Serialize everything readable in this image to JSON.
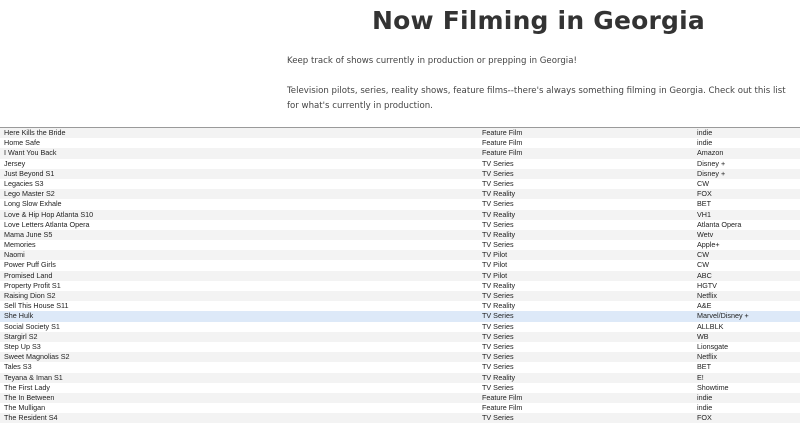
{
  "page": {
    "title": "Now Filming in Georgia",
    "intro_1": "Keep track of shows currently in production or prepping in Georgia!",
    "intro_2": "Television pilots, series, reality shows, feature films--there's always something filming in Georgia. Check out this list for what's currently in production."
  },
  "colors": {
    "row_alt": "#f3f3f3",
    "row_highlight": "#dde9f8",
    "title_text": "#333333"
  },
  "table": {
    "highlighted_row": "She Hulk",
    "rows": [
      {
        "title": "Here Kills the Bride",
        "type": "Feature Film",
        "network": "indie"
      },
      {
        "title": "Home Safe",
        "type": "Feature Film",
        "network": "indie"
      },
      {
        "title": "I Want You Back",
        "type": "Feature Film",
        "network": "Amazon"
      },
      {
        "title": "Jersey",
        "type": "TV Series",
        "network": "Disney +"
      },
      {
        "title": "Just Beyond S1",
        "type": "TV Series",
        "network": "Disney +"
      },
      {
        "title": "Legacies S3",
        "type": "TV Series",
        "network": "CW"
      },
      {
        "title": "Lego Master S2",
        "type": "TV Reality",
        "network": "FOX"
      },
      {
        "title": "Long Slow Exhale",
        "type": "TV Series",
        "network": "BET"
      },
      {
        "title": "Love & Hip Hop Atlanta S10",
        "type": "TV Reality",
        "network": "VH1"
      },
      {
        "title": "Love Letters Atlanta Opera",
        "type": "TV Series",
        "network": "Atlanta Opera"
      },
      {
        "title": "Mama June S5",
        "type": "TV Reality",
        "network": "Wetv"
      },
      {
        "title": "Memories",
        "type": "TV Series",
        "network": "Apple+"
      },
      {
        "title": "Naomi",
        "type": "TV Pilot",
        "network": "CW"
      },
      {
        "title": "Power Puff Girls",
        "type": "TV Pilot",
        "network": "CW"
      },
      {
        "title": "Promised Land",
        "type": "TV Pilot",
        "network": "ABC"
      },
      {
        "title": "Property Profit S1",
        "type": "TV Reality",
        "network": "HGTV"
      },
      {
        "title": "Raising Dion S2",
        "type": "TV Series",
        "network": "Netflix"
      },
      {
        "title": "Sell This House S11",
        "type": "TV Reality",
        "network": "A&E"
      },
      {
        "title": "She Hulk",
        "type": "TV Series",
        "network": "Marvel/Disney +"
      },
      {
        "title": "Social Society S1",
        "type": "TV Series",
        "network": "ALLBLK"
      },
      {
        "title": "Stargirl S2",
        "type": "TV Series",
        "network": "WB"
      },
      {
        "title": "Step Up S3",
        "type": "TV Series",
        "network": "Lionsgate"
      },
      {
        "title": "Sweet Magnolias S2",
        "type": "TV Series",
        "network": "Netflix"
      },
      {
        "title": "Tales S3",
        "type": "TV Series",
        "network": "BET"
      },
      {
        "title": "Teyana & Iman S1",
        "type": "TV Reality",
        "network": "E!"
      },
      {
        "title": "The First Lady",
        "type": "TV Series",
        "network": "Showtime"
      },
      {
        "title": "The In Between",
        "type": "Feature Film",
        "network": "indie"
      },
      {
        "title": "The Mulligan",
        "type": "Feature Film",
        "network": "indie"
      },
      {
        "title": "The Resident S4",
        "type": "TV Series",
        "network": "FOX"
      }
    ]
  }
}
